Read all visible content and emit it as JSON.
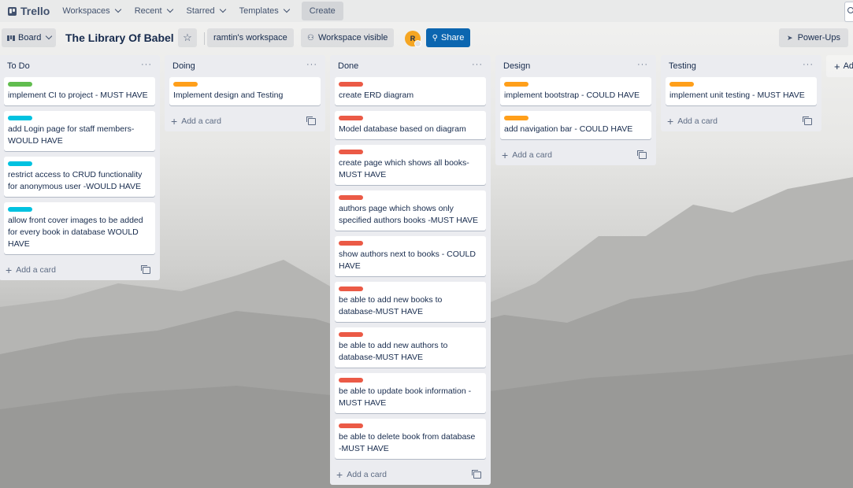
{
  "app": {
    "name": "Trello"
  },
  "topnav": {
    "workspaces": "Workspaces",
    "recent": "Recent",
    "starred": "Starred",
    "templates": "Templates",
    "create": "Create"
  },
  "board": {
    "view": "Board",
    "title": "The Library Of Babel",
    "workspace": "ramtin's workspace",
    "visibility": "Workspace visible",
    "avatar_initial": "R",
    "share": "Share",
    "powerups": "Power-Ups"
  },
  "colors": {
    "green": "#61bd4f",
    "cyan": "#00c2e0",
    "orange": "#ff9f1a",
    "red": "#eb5a46",
    "share": "#0c66b0"
  },
  "lists": [
    {
      "title": "To Do",
      "cards": [
        {
          "text": "implement CI to project - MUST HAVE",
          "label": "#61bd4f"
        },
        {
          "text": "add Login page for staff members-\nWOULD HAVE",
          "label": "#00c2e0"
        },
        {
          "text": "restrict access to CRUD functionality\nfor anonymous user -WOULD HAVE",
          "label": "#00c2e0"
        },
        {
          "text": "allow front cover images to be added\nfor every book in database WOULD\nHAVE",
          "label": "#00c2e0"
        }
      ],
      "add_card": "Add a card"
    },
    {
      "title": "Doing",
      "cards": [
        {
          "text": "Implement design and Testing",
          "label": "#ff9f1a"
        }
      ],
      "add_card": "Add a card"
    },
    {
      "title": "Done",
      "cards": [
        {
          "text": "create ERD diagram",
          "label": "#eb5a46"
        },
        {
          "text": "Model database based on diagram",
          "label": "#eb5a46"
        },
        {
          "text": "create page which shows all books-\nMUST HAVE",
          "label": "#eb5a46"
        },
        {
          "text": "authors page which shows only\nspecified authors books -MUST HAVE",
          "label": "#eb5a46"
        },
        {
          "text": "show authors next to books - COULD\nHAVE",
          "label": "#eb5a46"
        },
        {
          "text": "be able to add new books to\ndatabase-MUST HAVE",
          "label": "#eb5a46"
        },
        {
          "text": "be able to add new authors to\ndatabase-MUST HAVE",
          "label": "#eb5a46"
        },
        {
          "text": "be able to update book information -\nMUST HAVE",
          "label": "#eb5a46"
        },
        {
          "text": "be able to delete book from database\n-MUST HAVE",
          "label": "#eb5a46"
        }
      ],
      "add_card": "Add a card"
    },
    {
      "title": "Design",
      "cards": [
        {
          "text": "implement bootstrap - COULD HAVE",
          "label": "#ff9f1a"
        },
        {
          "text": "add navigation bar - COULD HAVE",
          "label": "#ff9f1a"
        }
      ],
      "add_card": "Add a card"
    },
    {
      "title": "Testing",
      "cards": [
        {
          "text": "implement unit testing - MUST HAVE",
          "label": "#ff9f1a"
        }
      ],
      "add_card": "Add a card"
    }
  ],
  "add_list": "Ad"
}
